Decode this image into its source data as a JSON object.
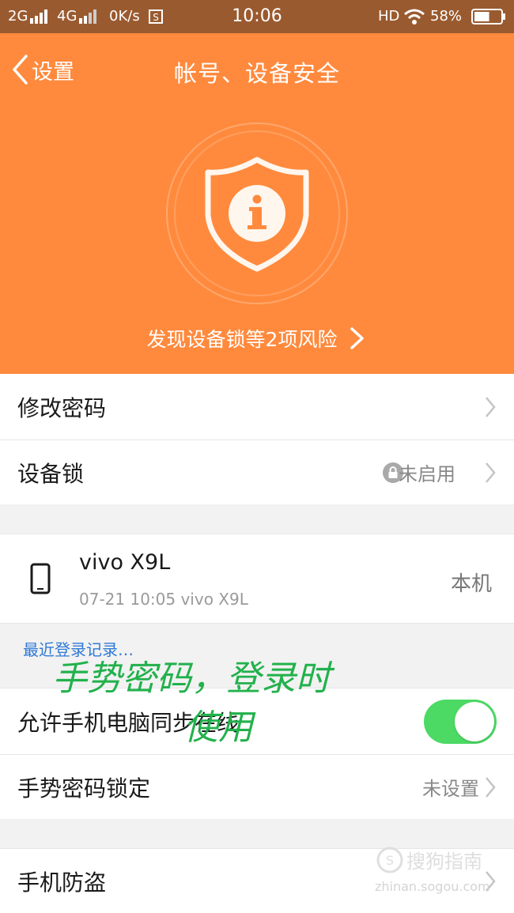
{
  "status_bar": {
    "signal_2g": "2G",
    "signal_4g": "4G",
    "speed": "0K/s",
    "time": "10:06",
    "hd": "HD",
    "battery": "58%",
    "battery_level": 0.58
  },
  "header": {
    "back_label": "设置",
    "title": "帐号、设备安全",
    "risk_text": "发现设备锁等2项风险",
    "shield_icon": "shield-info-icon",
    "color": "#ff8a3d"
  },
  "rows": {
    "change_password": "修改密码",
    "device_lock": {
      "label": "设备锁",
      "status": "未启用"
    },
    "device": {
      "name": "vivo X9L",
      "sub": "07-21 10:05 vivo X9L",
      "self": "本机"
    },
    "recent_login": "最近登录记录",
    "sync_online": {
      "label": "允许手机电脑同步在线",
      "on": true
    },
    "gesture_lock": {
      "label": "手势密码锁定",
      "status": "未设置"
    },
    "anti_theft": "手机防盗"
  },
  "annotation": {
    "line1": "手势密码，登录时",
    "line2": "使用",
    "color": "#22b14c"
  },
  "watermark": {
    "brand": "搜狗指南",
    "url": "zhinan.sogou.com"
  }
}
